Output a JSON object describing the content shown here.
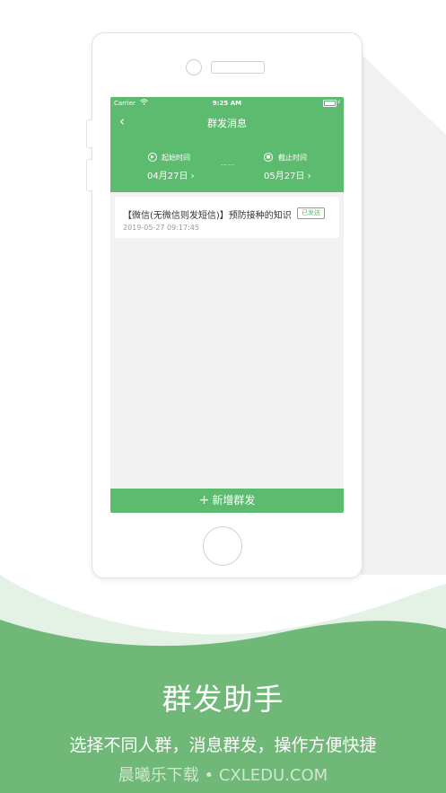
{
  "statusbar": {
    "carrier": "Carrier",
    "time": "9:25 AM"
  },
  "header": {
    "title": "群发消息",
    "back_icon": "‹"
  },
  "range": {
    "start_label": "起始时间",
    "start_date": "04月27日 ›",
    "end_label": "截止时间",
    "end_date": "05月27日 ›",
    "separator": "……"
  },
  "messages": [
    {
      "title": "【微信(无微信则发短信)】预防接种的知识",
      "status": "已发送",
      "time": "2019-05-27 09:17:45"
    }
  ],
  "new_button": {
    "icon": "+",
    "label": "新增群发"
  },
  "promo": {
    "headline": "群发助手",
    "subline": "选择不同人群，消息群发，操作方便快捷",
    "watermark": "晨曦乐下载 • CXLEDU.COM"
  },
  "colors": {
    "accent": "#5dbb6f",
    "wave": "#6fb877",
    "wave_light": "#dcefe0"
  }
}
